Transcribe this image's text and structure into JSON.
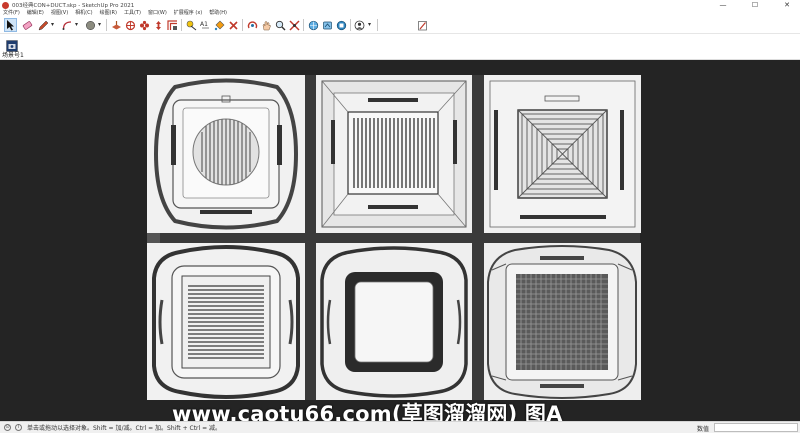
{
  "window": {
    "title": "003经典CON+DUCT.skp - SketchUp Pro 2021",
    "minimize": "—",
    "maximize": "☐",
    "close": "✕"
  },
  "menu": {
    "items": [
      "文件(F)",
      "编辑(E)",
      "视图(V)",
      "相机(C)",
      "绘图(R)",
      "工具(T)",
      "窗口(W)",
      "扩展程序 (x)",
      "帮助(H)"
    ]
  },
  "toolbar": {
    "tools": [
      {
        "name": "select-tool",
        "icon": "arrow-cursor-icon",
        "active": true
      },
      {
        "name": "eraser-tool",
        "icon": "eraser-icon"
      },
      {
        "name": "line-tool",
        "icon": "pencil-icon"
      },
      {
        "name": "arc-tool",
        "icon": "arc-icon"
      },
      {
        "name": "shape-tool",
        "icon": "circle-shape-icon"
      },
      {
        "name": "push-pull-tool",
        "icon": "push-pull-icon"
      },
      {
        "name": "move-tool",
        "icon": "move-cross-icon"
      },
      {
        "name": "rotate-tool",
        "icon": "rotate-icon"
      },
      {
        "name": "scale-tool",
        "icon": "scale-icon"
      },
      {
        "name": "offset-tool",
        "icon": "offset-icon"
      },
      {
        "name": "tape-measure-tool",
        "icon": "tape-measure-icon"
      },
      {
        "name": "text-tool",
        "icon": "text-a1-icon"
      },
      {
        "name": "paint-bucket-tool",
        "icon": "paint-bucket-icon"
      },
      {
        "name": "orbit-tool",
        "icon": "orbit-icon"
      },
      {
        "name": "pan-tool",
        "icon": "hand-icon"
      },
      {
        "name": "zoom-tool",
        "icon": "magnifier-icon"
      },
      {
        "name": "zoom-extents-tool",
        "icon": "zoom-extents-icon"
      },
      {
        "name": "warehouse-tool",
        "icon": "warehouse-icon"
      },
      {
        "name": "share-model-tool",
        "icon": "share-model-icon"
      },
      {
        "name": "extension-warehouse-tool",
        "icon": "extension-warehouse-icon"
      },
      {
        "name": "layout-tool",
        "icon": "layout-icon"
      },
      {
        "name": "account-tool",
        "icon": "user-icon"
      },
      {
        "name": "notes-tool",
        "icon": "notepad-icon"
      }
    ],
    "accent": "#cfe4f7"
  },
  "scenes": {
    "tab_label": "场景号1"
  },
  "viewport": {
    "background": "#242424",
    "tile_color": "#efefef",
    "grille_color": "#4a4a4a"
  },
  "watermark": {
    "text": "www.caotu66.com(草图溜溜网) 图A"
  },
  "statusbar": {
    "hint": "单击或拖动以选择对象。Shift = 加/减。Ctrl = 加。Shift + Ctrl = 减。",
    "measurements_label": "数值",
    "measurements_value": ""
  }
}
